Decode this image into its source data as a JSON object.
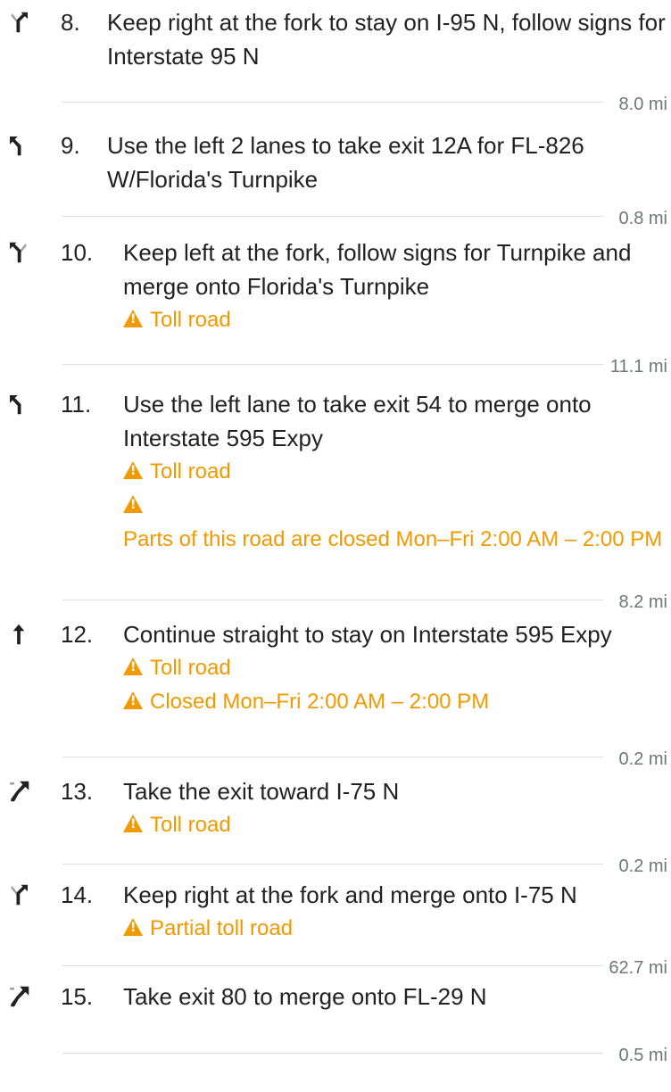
{
  "steps": [
    {
      "number": "8.",
      "icon": "keep-right-icon",
      "text": "Keep right at the fork to stay on I-95 N, follow signs for Interstate 95 N",
      "warnings": [],
      "distance": "8.0 mi"
    },
    {
      "number": "9.",
      "icon": "turn-slight-left-icon",
      "text": "Use the left 2 lanes to take exit 12A for FL-826 W/Florida's Turnpike",
      "warnings": [],
      "distance": "0.8 mi"
    },
    {
      "number": "10.",
      "icon": "keep-left-icon",
      "text": "Keep left at the fork, follow signs for Turnpike and merge onto Florida's Turnpike",
      "warnings": [
        "Toll road"
      ],
      "distance": "11.1 mi"
    },
    {
      "number": "11.",
      "icon": "turn-slight-left-icon",
      "text": "Use the left lane to take exit 54 to merge onto Interstate 595 Expy",
      "warnings": [
        "Toll road",
        "",
        "Parts of this road are closed Mon–Fri 2:00 AM – 2:00 PM"
      ],
      "distance": "8.2 mi"
    },
    {
      "number": "12.",
      "icon": "straight-icon",
      "text": "Continue straight to stay on Interstate 595 Expy",
      "warnings": [
        "Toll road",
        "Closed Mon–Fri 2:00 AM – 2:00 PM"
      ],
      "distance": "0.2 mi"
    },
    {
      "number": "13.",
      "icon": "ramp-right-icon",
      "text": "Take the exit toward I-75 N",
      "warnings": [
        "Toll road"
      ],
      "distance": "0.2 mi"
    },
    {
      "number": "14.",
      "icon": "keep-right-icon",
      "text": "Keep right at the fork and merge onto I-75 N",
      "warnings": [
        "Partial toll road"
      ],
      "distance": "62.7 mi"
    },
    {
      "number": "15.",
      "icon": "ramp-right-icon",
      "text": "Take exit 80 to merge onto FL-29 N",
      "warnings": [],
      "distance": "0.5 mi"
    }
  ],
  "colors": {
    "warning": "#f29900",
    "divider": "#dadce0",
    "distance": "#70757a",
    "icon": "#212121"
  }
}
